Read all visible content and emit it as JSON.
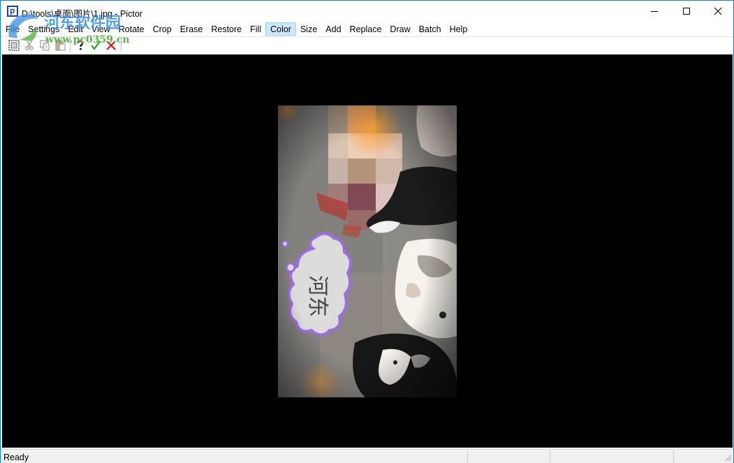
{
  "window": {
    "title": "D:\\tools\\桌面\\图片\\1.jpg - Pictor",
    "app_icon_letter": "p"
  },
  "menu": {
    "items": [
      {
        "label": "File"
      },
      {
        "label": "Settings"
      },
      {
        "label": "Edit"
      },
      {
        "label": "View"
      },
      {
        "label": "Rotate"
      },
      {
        "label": "Crop"
      },
      {
        "label": "Erase"
      },
      {
        "label": "Restore"
      },
      {
        "label": "Fill"
      },
      {
        "label": "Color"
      },
      {
        "label": "Size"
      },
      {
        "label": "Add"
      },
      {
        "label": "Replace"
      },
      {
        "label": "Draw"
      },
      {
        "label": "Batch"
      },
      {
        "label": "Help"
      }
    ],
    "active": "Color"
  },
  "toolbar": {
    "icons": [
      "select-rect-icon",
      "cut-icon",
      "copy-icon",
      "paste-icon",
      "help-icon",
      "apply-icon",
      "cancel-icon"
    ]
  },
  "image": {
    "speech_text": "河东"
  },
  "status": {
    "text": "Ready"
  },
  "watermark": {
    "title": "河东软件园",
    "url": "www.pc0359.cn"
  },
  "colors": {
    "menu_highlight": "#cce8ff",
    "canvas_bg": "#000000",
    "frame_border": "#1e78d2"
  }
}
